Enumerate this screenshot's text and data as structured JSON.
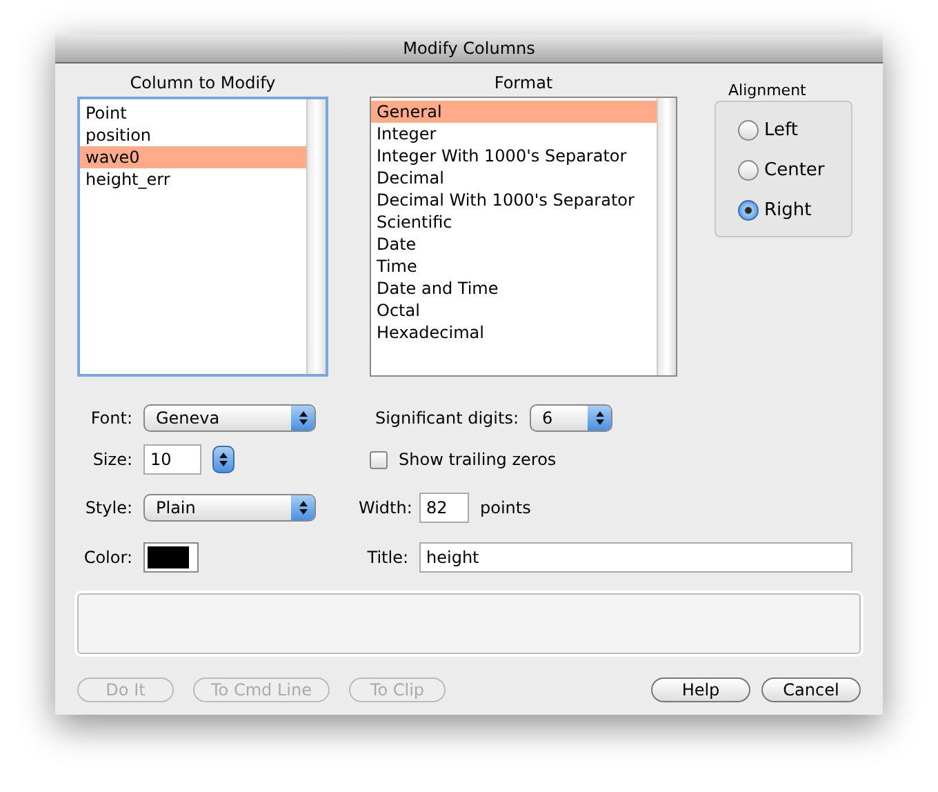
{
  "window": {
    "title": "Modify Columns"
  },
  "column_list": {
    "label": "Column to Modify",
    "items": [
      {
        "text": "Point",
        "selected": false
      },
      {
        "text": "position",
        "selected": false
      },
      {
        "text": "wave0",
        "selected": true
      },
      {
        "text": "height_err",
        "selected": false
      }
    ]
  },
  "format_list": {
    "label": "Format",
    "items": [
      {
        "text": "General",
        "selected": true
      },
      {
        "text": "Integer",
        "selected": false
      },
      {
        "text": "Integer With 1000's Separator",
        "selected": false
      },
      {
        "text": "Decimal",
        "selected": false
      },
      {
        "text": "Decimal With 1000's Separator",
        "selected": false
      },
      {
        "text": "Scientific",
        "selected": false
      },
      {
        "text": "Date",
        "selected": false
      },
      {
        "text": "Time",
        "selected": false
      },
      {
        "text": "Date and Time",
        "selected": false
      },
      {
        "text": "Octal",
        "selected": false
      },
      {
        "text": "Hexadecimal",
        "selected": false
      }
    ]
  },
  "alignment": {
    "label": "Alignment",
    "options": [
      {
        "label": "Left",
        "selected": false
      },
      {
        "label": "Center",
        "selected": false
      },
      {
        "label": "Right",
        "selected": true
      }
    ]
  },
  "font": {
    "label": "Font:",
    "value": "Geneva"
  },
  "size": {
    "label": "Size:",
    "value": "10"
  },
  "style": {
    "label": "Style:",
    "value": "Plain"
  },
  "color": {
    "label": "Color:",
    "color": "#000000"
  },
  "significant_digits": {
    "label": "Significant digits:",
    "value": "6"
  },
  "show_trailing_zeros": {
    "label": "Show trailing zeros",
    "checked": false
  },
  "width": {
    "label": "Width:",
    "value": "82",
    "unit": "points"
  },
  "title_field": {
    "label": "Title:",
    "value": "height"
  },
  "buttons": [
    {
      "label": "Do It",
      "disabled": true
    },
    {
      "label": "To Cmd Line",
      "disabled": true
    },
    {
      "label": "To Clip",
      "disabled": true
    },
    {
      "label": "Help",
      "disabled": false
    },
    {
      "label": "Cancel",
      "disabled": false
    }
  ]
}
